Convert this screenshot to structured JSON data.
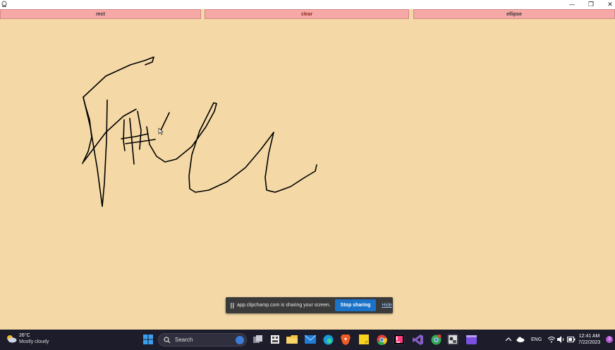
{
  "window": {
    "minimize_glyph": "—",
    "maximize_glyph": "❐",
    "close_glyph": "✕"
  },
  "toolbar": {
    "rect_label": "rect",
    "clear_label": "clear",
    "ellipse_label": "ellipse"
  },
  "share_banner": {
    "message": "app.clipchamp.com is sharing your screen.",
    "stop_label": "Stop sharing",
    "hide_label": "Hide"
  },
  "taskbar": {
    "weather_temp": "26°C",
    "weather_desc": "Mostly cloudy",
    "search_label": "Search",
    "language": "ENG",
    "time": "12:41 AM",
    "date": "7/22/2023",
    "notification_count": "3"
  },
  "colors": {
    "canvas_bg": "#f4d9a6",
    "button_bg": "#f5a8a6",
    "taskbar_bg": "#1c1c2a",
    "share_stop_bg": "#1a73c8"
  }
}
